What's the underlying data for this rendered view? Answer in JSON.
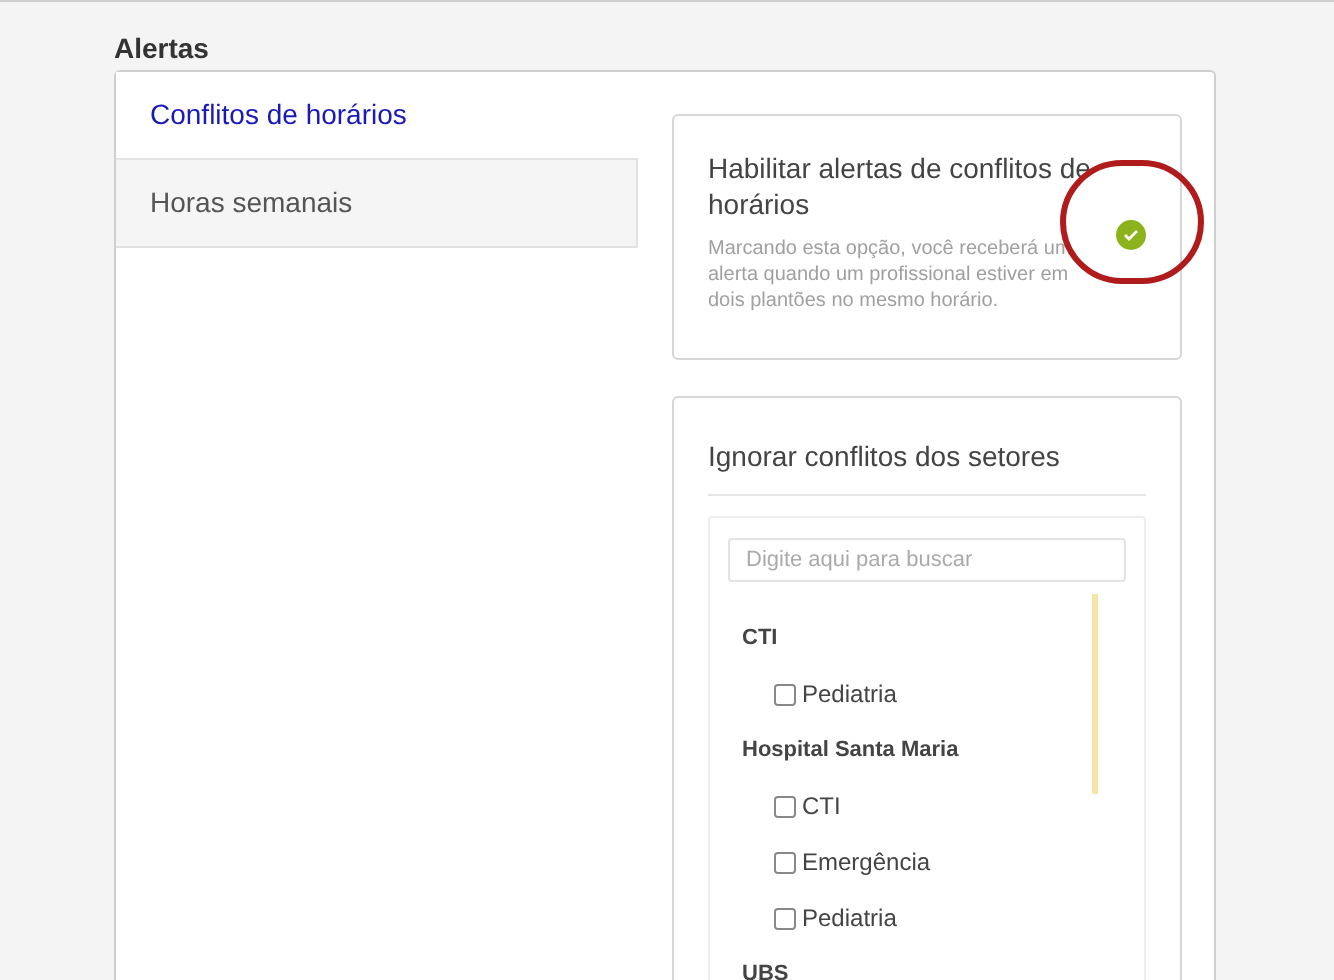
{
  "section_title": "Alertas",
  "sidebar": {
    "items": [
      {
        "label": "Conflitos de horários",
        "selected": true
      },
      {
        "label": "Horas semanais",
        "selected": false
      }
    ]
  },
  "alert_card": {
    "title": "Habilitar alertas de conflitos de horários",
    "description": "Marcando esta opção, você receberá um alerta quando um profissional estiver em dois plantões no mesmo horário.",
    "checked": true
  },
  "sectors_card": {
    "title": "Ignorar conflitos dos setores",
    "search": {
      "placeholder": "Digite aqui para buscar"
    },
    "tree": [
      {
        "label": "CTI",
        "children": [
          {
            "label": "Pediatria",
            "checked": false
          }
        ]
      },
      {
        "label": "Hospital Santa Maria",
        "children": [
          {
            "label": "CTI",
            "checked": false
          },
          {
            "label": "Emergência",
            "checked": false
          },
          {
            "label": "Pediatria",
            "checked": false
          }
        ]
      },
      {
        "label": "UBS"
      }
    ]
  }
}
